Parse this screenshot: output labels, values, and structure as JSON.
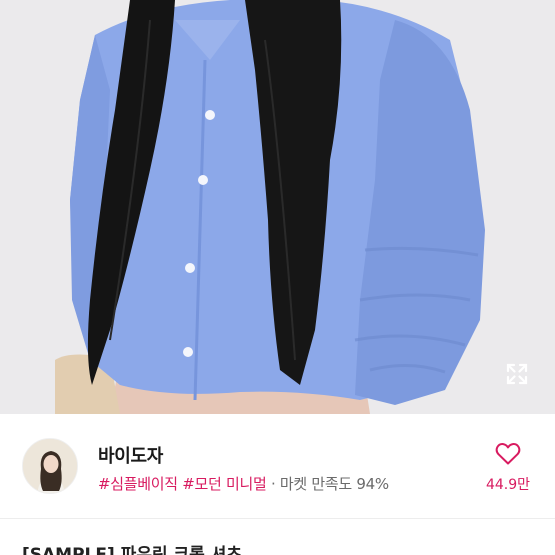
{
  "product": {
    "title": "[SAMPLE] 파우린 크롭 셔츠"
  },
  "seller": {
    "name": "바이도자",
    "tags": [
      "#심플베이직",
      "#모던 미니멀"
    ],
    "separator": "·",
    "satisfaction_label": "마켓 만족도",
    "satisfaction_value": "94%"
  },
  "like": {
    "count": "44.9만"
  },
  "icons": {
    "expand": "expand-icon",
    "like": "heart-icon",
    "avatar": "avatar"
  },
  "colors": {
    "accent": "#d81b60",
    "shirt": "#8ba7e8",
    "hair": "#151515"
  }
}
